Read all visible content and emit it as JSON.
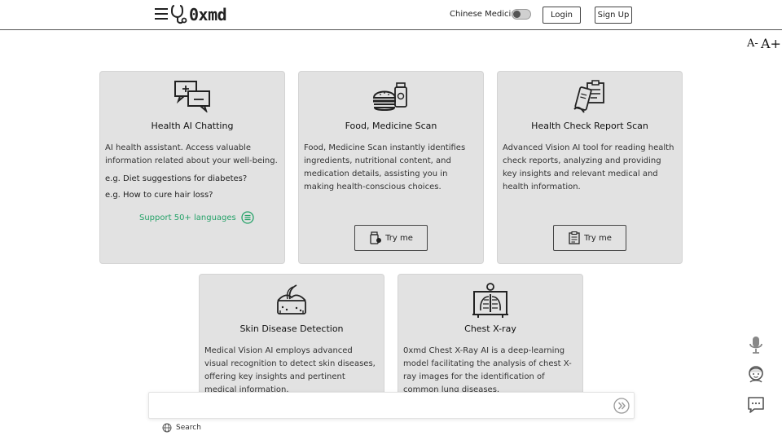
{
  "header": {
    "logo_text": "0xmd",
    "chinese_medicine_label": "Chinese Medicine",
    "chinese_medicine_on": false,
    "login_label": "Login",
    "signup_label": "Sign Up"
  },
  "font_controls": {
    "decrease_label": "A-",
    "increase_label": "A+"
  },
  "cards": [
    {
      "icon": "chat-bubbles-icon",
      "title": "Health AI Chatting",
      "description": "AI health assistant. Access valuable information related about your well-being.",
      "examples": [
        "e.g. Diet suggestions for diabetes?",
        "e.g. How to cure hair loss?"
      ],
      "languages_link": "Support 50+ languages"
    },
    {
      "icon": "burger-bottle-icon",
      "title": "Food, Medicine Scan",
      "description": "Food, Medicine Scan instantly identifies ingredients, nutritional content, and medication details, assisting you in making health-conscious choices.",
      "button_label": "Try me"
    },
    {
      "icon": "report-scan-icon",
      "title": "Health Check Report Scan",
      "description": "Advanced Vision AI tool for reading health check reports, analyzing and providing key insights and relevant medical and health information.",
      "button_label": "Try me"
    },
    {
      "icon": "skin-icon",
      "title": "Skin Disease Detection",
      "description": "Medical Vision AI employs advanced visual recognition to detect skin diseases, offering key insights and pertinent medical information."
    },
    {
      "icon": "xray-icon",
      "title": "Chest X-ray",
      "description": "0xmd Chest X-Ray AI is a deep-learning model facilitating the analysis of chest X-ray images for the identification of common lung diseases."
    }
  ],
  "chat": {
    "placeholder": "",
    "search_label": "Search"
  },
  "colors": {
    "card_bg": "#e2e2e2",
    "accent_green": "#26a269"
  }
}
